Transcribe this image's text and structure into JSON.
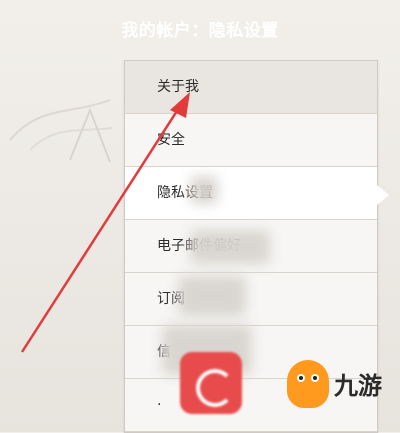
{
  "header": {
    "title": "我的帐户：隐私设置"
  },
  "menu": {
    "items": [
      {
        "label": "关于我"
      },
      {
        "label": "安全"
      },
      {
        "label": "隐私设置"
      },
      {
        "label": "电子邮件偏好"
      },
      {
        "label": "订阅"
      },
      {
        "label": "信"
      },
      {
        "label": "·"
      }
    ],
    "active_index": 2
  },
  "watermark": {
    "text": "九游"
  },
  "colors": {
    "arrow": "#e23b3b",
    "watermark_badge": "#e84b4b",
    "mascot": "#ff9a1f"
  }
}
